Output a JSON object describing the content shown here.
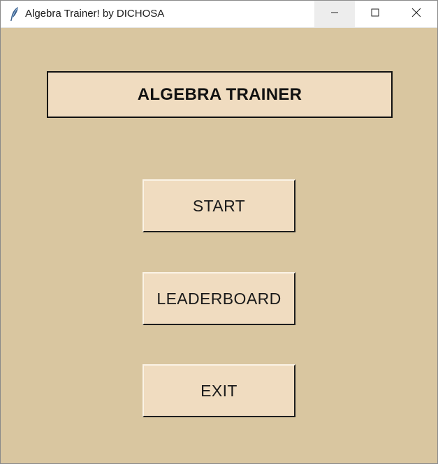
{
  "window": {
    "title": "Algebra Trainer! by DICHOSA",
    "app_icon": "feather-icon",
    "controls": [
      "minimize-icon",
      "maximize-icon",
      "close-icon"
    ]
  },
  "main": {
    "heading": "ALGEBRA TRAINER",
    "buttons": {
      "start": "START",
      "leaderboard": "LEADERBOARD",
      "exit": "EXIT"
    }
  },
  "colors": {
    "background": "#d9c6a0",
    "button_face": "#f0dcc0",
    "text": "#1a1a1a"
  }
}
